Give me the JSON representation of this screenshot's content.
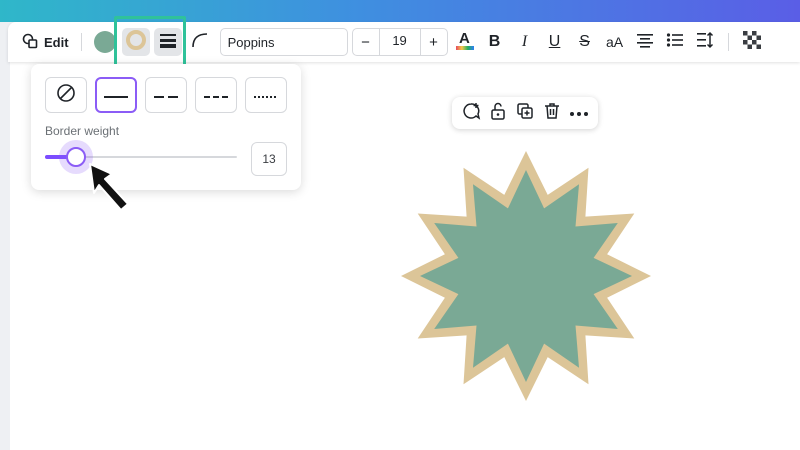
{
  "toolbar": {
    "edit_label": "Edit",
    "fill_color": "#7aa995",
    "border_color": "#dcc598",
    "font_family": "Poppins",
    "font_size": "19",
    "decrease_label": "−",
    "increase_label": "+",
    "case_label": "aA",
    "bold_label": "B",
    "italic_label": "I",
    "underline_label": "U",
    "strike_label": "S"
  },
  "border_popover": {
    "styles": [
      "none",
      "solid",
      "long-dash",
      "short-dash",
      "dotted"
    ],
    "selected_style": "solid",
    "weight_label": "Border weight",
    "weight_value": "13",
    "weight_fraction": 0.16
  },
  "context_menu": [
    "comment-add-icon",
    "unlock-icon",
    "duplicate-icon",
    "trash-icon",
    "more-icon"
  ],
  "shape": {
    "type": "12-point star",
    "fill": "#7aa995",
    "border": "#dcc598"
  },
  "colors": {
    "accent": "#8b5cf6",
    "highlight": "#2fc29a"
  }
}
